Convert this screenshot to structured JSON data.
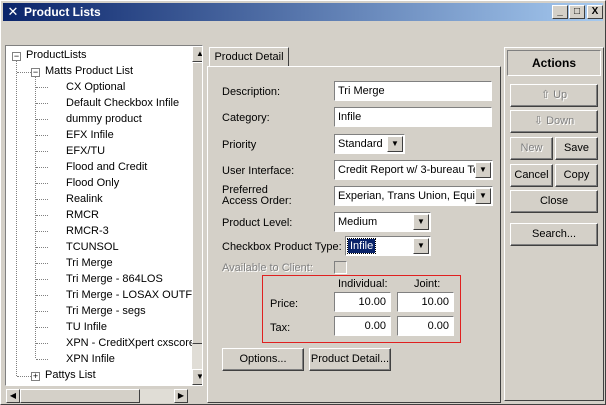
{
  "window": {
    "title": "Product Lists",
    "controls": {
      "minimize": "_",
      "maximize": "□",
      "close": "X"
    }
  },
  "tree": {
    "root": "ProductLists",
    "group1": "Matts Product List",
    "items": [
      "CX Optional",
      "Default Checkbox Infile",
      "dummy product",
      "EFX Infile",
      "EFX/TU",
      "Flood and Credit",
      "Flood Only",
      "Realink",
      "RMCR",
      "RMCR-3",
      "TCUNSOL",
      "Tri Merge",
      "Tri Merge - 864LOS",
      "Tri Merge - LOSAX OUTF",
      "Tri Merge - segs",
      "TU Infile",
      "XPN - CreditXpert cxscore",
      "XPN Infile"
    ],
    "group2": "Pattys List",
    "expand_minus": "−",
    "expand_plus": "+"
  },
  "detail": {
    "tab_label": "Product Detail",
    "description_label": "Description:",
    "description_value": "Tri Merge",
    "category_label": "Category:",
    "category_value": "Infile",
    "priority_label": "Priority",
    "priority_value": "Standard",
    "ui_label": "User Interface:",
    "ui_value": "Credit Report w/ 3-bureau Te",
    "access_label_1": "Preferred",
    "access_label_2": "Access Order:",
    "access_value": "Experian, Trans Union, Equifa",
    "level_label": "Product Level:",
    "level_value": "Medium",
    "checkbox_type_label": "Checkbox Product Type:",
    "checkbox_type_value": "Infile",
    "available_label": "Available to Client:",
    "individual_label": "Individual:",
    "joint_label": "Joint:",
    "price_label": "Price:",
    "price_individual": "10.00",
    "price_joint": "10.00",
    "tax_label": "Tax:",
    "tax_individual": "0.00",
    "tax_joint": "0.00",
    "options_button": "Options...",
    "product_detail_button": "Product Detail..."
  },
  "actions": {
    "header": "Actions",
    "up": "Up",
    "down": "Down",
    "new": "New",
    "save": "Save",
    "cancel": "Cancel",
    "copy": "Copy",
    "close": "Close",
    "search": "Search..."
  }
}
